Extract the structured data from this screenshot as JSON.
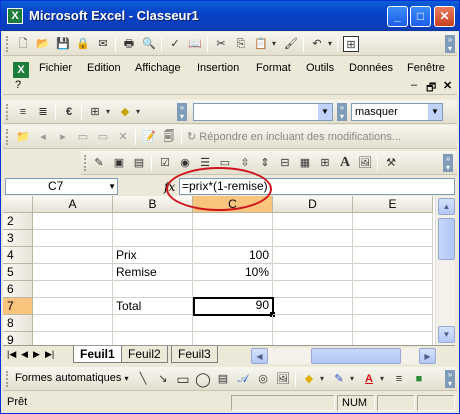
{
  "window": {
    "title": "Microsoft Excel - Classeur1"
  },
  "menu": {
    "items": [
      {
        "label": "Fichier"
      },
      {
        "label": "Edition"
      },
      {
        "label": "Affichage"
      },
      {
        "label": "Insertion"
      },
      {
        "label": "Format"
      },
      {
        "label": "Outils"
      },
      {
        "label": "Données"
      },
      {
        "label": "Fenêtre"
      }
    ],
    "help": "?"
  },
  "format_toolbar": {
    "font_size_value": "",
    "search_value": "masquer"
  },
  "reviewing_toolbar": {
    "reply_label": "Répondre en incluant des modifications..."
  },
  "formula_bar": {
    "name_box": "C7",
    "fx": "fx",
    "formula": "=prix*(1-remise)"
  },
  "grid": {
    "columns": [
      "A",
      "B",
      "C",
      "D",
      "E"
    ],
    "selected_column": "C",
    "rows": [
      {
        "n": "2",
        "A": "",
        "B": "",
        "C": "",
        "D": "",
        "E": ""
      },
      {
        "n": "3",
        "A": "",
        "B": "",
        "C": "",
        "D": "",
        "E": ""
      },
      {
        "n": "4",
        "A": "",
        "B": "Prix",
        "C": "100",
        "D": "",
        "E": ""
      },
      {
        "n": "5",
        "A": "",
        "B": "Remise",
        "C": "10%",
        "D": "",
        "E": ""
      },
      {
        "n": "6",
        "A": "",
        "B": "",
        "C": "",
        "D": "",
        "E": ""
      },
      {
        "n": "7",
        "A": "",
        "B": "Total",
        "C": "90",
        "D": "",
        "E": ""
      },
      {
        "n": "8",
        "A": "",
        "B": "",
        "C": "",
        "D": "",
        "E": ""
      },
      {
        "n": "9",
        "A": "",
        "B": "",
        "C": "",
        "D": "",
        "E": ""
      }
    ],
    "selected_row": "7",
    "active_cell": "C7"
  },
  "sheets": [
    {
      "label": "Feuil1",
      "active": true
    },
    {
      "label": "Feuil2"
    },
    {
      "label": "Feuil3"
    }
  ],
  "drawing_toolbar": {
    "autoshapes_label": "Formes automatiques"
  },
  "status": {
    "text": "Prêt",
    "num": "NUM"
  },
  "colors": {
    "title_bar": "#0a4fd0",
    "selection_header": "#f9c47e",
    "highlight_ellipse": "#d0141c"
  }
}
